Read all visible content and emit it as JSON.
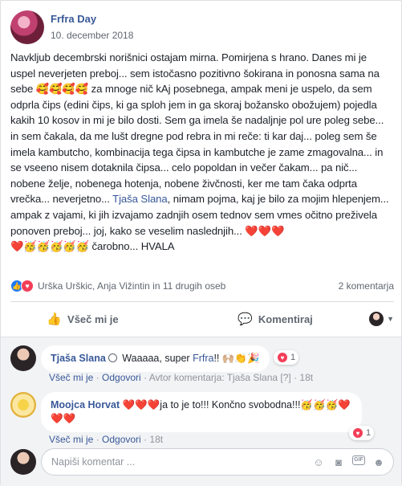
{
  "post": {
    "author": "Frfra Day",
    "date": "10. december 2018",
    "text_part1": "Navkljub decembrski norišnici ostajam mirna. Pomirjena s hrano. Danes mi je uspel neverjeten preboj... sem istočasno pozitivno šokirana in ponosna sama na sebe ",
    "emoji_1": "🥰🥰🥰🥰",
    "text_part2": " za mnoge nič kAj posebnega, ampak meni je uspelo, da sem odprla čips (edini čips, ki ga sploh jem in ga skoraj božansko obožujem) pojedla kakih 10 kosov in mi je bilo dosti. Sem ga imela še nadaljnje pol ure poleg sebe... in sem čakala, da me lušt dregne pod rebra in mi reče: ti kar daj... poleg sem še imela kambutcho, kombinacija tega čipsa in kambutche je zame zmagovalna... in se vseeno nisem dotaknila čipsa... celo popoldan in večer čakam... pa nič... nobene želje, nobenega hotenja, nobene živčnosti, ker me tam čaka odprta vrečka... neverjetno... ",
    "mention": "Tjaša Slana",
    "text_part3": ", nimam pojma, kaj je bilo za mojim hlepenjem... ampak z vajami, ki jih izvajamo zadnjih osem tednov sem vmes očitno preživela ponoven preboj... joj, kako se veselim naslednjih... ",
    "emoji_2": "❤️❤️❤️",
    "emoji_3": "❤️🥳🥳🥳🥳🥳",
    "text_part4": " čarobno... HVALA"
  },
  "reactions": {
    "like_icon": "like-icon",
    "love_icon": "love-icon",
    "summary": "Urška Urškic, Anja Vižintin in 11 drugih oseb",
    "comment_count": "2 komentarja"
  },
  "actions": {
    "like_label": "Všeč mi je",
    "comment_label": "Komentiraj"
  },
  "comments": [
    {
      "author": "Tjaša Slana",
      "text_before": "Waaaaa, super ",
      "mention": "Frfra",
      "text_after": "!! 🙌🏼👏🎉",
      "reaction_count": "1",
      "like_label": "Všeč mi je",
      "reply_label": "Odgovori",
      "author_note": "Avtor komentarja: Tjaša Slana",
      "edit_marker": "[?]",
      "time": "18t"
    },
    {
      "author": "Moojca Horvat",
      "text": " ❤️❤️❤️ja to je to!!! Končno svobodna!!!🥳🥳🥳❤️❤️❤️",
      "reaction_count": "1",
      "like_label": "Všeč mi je",
      "reply_label": "Odgovori",
      "time": "18t"
    }
  ],
  "composer": {
    "placeholder": "Napiši komentar ..."
  },
  "colors": {
    "link": "#385898",
    "love": "#f33e58",
    "like": "#2078f4"
  }
}
